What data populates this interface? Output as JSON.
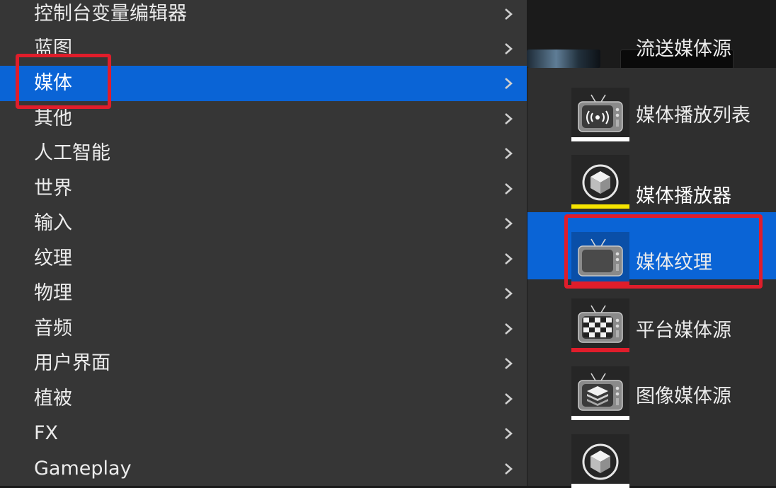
{
  "colors": {
    "menu_bg": "#363636",
    "submenu_bg": "#2f2f2f",
    "selection": "#0a64d6",
    "highlight": "#e01d2b",
    "text": "#ececec"
  },
  "left_menu": {
    "items": [
      {
        "label": "控制台变量编辑器",
        "icon": "chevron-right-icon"
      },
      {
        "label": "蓝图",
        "icon": "chevron-right-icon"
      },
      {
        "label": "媒体",
        "icon": "chevron-right-icon",
        "selected": true
      },
      {
        "label": "其他",
        "icon": "chevron-right-icon"
      },
      {
        "label": "人工智能",
        "icon": "chevron-right-icon"
      },
      {
        "label": "世界",
        "icon": "chevron-right-icon"
      },
      {
        "label": "输入",
        "icon": "chevron-right-icon"
      },
      {
        "label": "纹理",
        "icon": "chevron-right-icon"
      },
      {
        "label": "物理",
        "icon": "chevron-right-icon"
      },
      {
        "label": "音频",
        "icon": "chevron-right-icon"
      },
      {
        "label": "用户界面",
        "icon": "chevron-right-icon"
      },
      {
        "label": "植被",
        "icon": "chevron-right-icon"
      },
      {
        "label": "FX",
        "icon": "chevron-right-icon"
      },
      {
        "label": "Gameplay",
        "icon": "chevron-right-icon"
      }
    ]
  },
  "media_submenu": {
    "items": [
      {
        "label": "流送媒体源",
        "icon": "stream-tv-icon",
        "bar_color": "#ffffff"
      },
      {
        "label": "媒体播放列表",
        "icon": "cube-icon",
        "bar_color": "#f5e400"
      },
      {
        "label": "媒体播放器",
        "icon": "tv-icon",
        "bar_color": "#e01d2b",
        "selected": true
      },
      {
        "label": "媒体纹理",
        "icon": "checker-tv-icon",
        "bar_color": "#e01d2b"
      },
      {
        "label": "平台媒体源",
        "icon": "layers-tv-icon",
        "bar_color": "#ffffff"
      },
      {
        "label": "图像媒体源",
        "icon": "cube-icon",
        "bar_color": "#ffffff"
      }
    ]
  }
}
